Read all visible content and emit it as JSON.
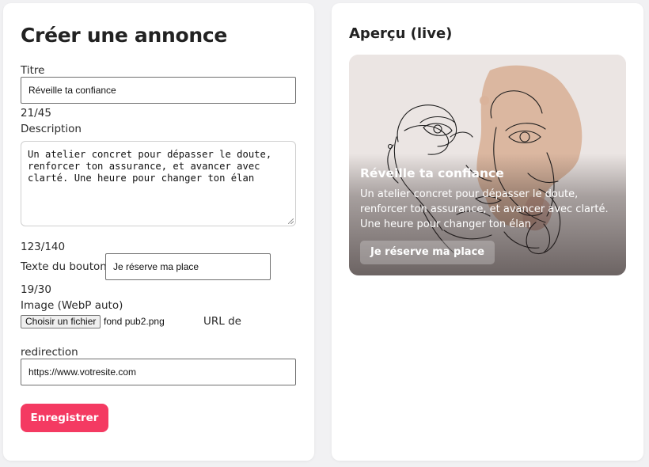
{
  "form": {
    "title": "Créer une annonce",
    "titre": {
      "label": "Titre",
      "value": "Réveille ta confiance",
      "counter": "21/45"
    },
    "description": {
      "label": "Description",
      "value": "Un atelier concret pour dépasser le doute,\nrenforcer ton assurance, et avancer avec\nclarté. Une heure pour changer ton élan",
      "counter": "123/140"
    },
    "bouton": {
      "label": "Texte du bouton",
      "value": "Je réserve ma place",
      "counter": "19/30"
    },
    "image": {
      "label": "Image (WebP auto)",
      "button_label": "Choisir un fichier",
      "file_name": "fond pub2.png"
    },
    "url": {
      "label_part1": "URL de",
      "label_part2": "redirection",
      "value": "https://www.votresite.com"
    },
    "save_label": "Enregistrer"
  },
  "preview": {
    "title": "Aperçu (live)",
    "banner": {
      "heading": "Réveille ta confiance",
      "description": "Un atelier concret pour dépasser le doute, renforcer ton assurance, et avancer avec clarté. Une heure pour changer ton élan",
      "button": "Je réserve ma place",
      "background_image": "line-art-face-illustration"
    }
  },
  "colors": {
    "accent": "#f43a62",
    "background": "#f1f1f3",
    "card": "#ffffff",
    "art_blob": "#d9b39a"
  }
}
